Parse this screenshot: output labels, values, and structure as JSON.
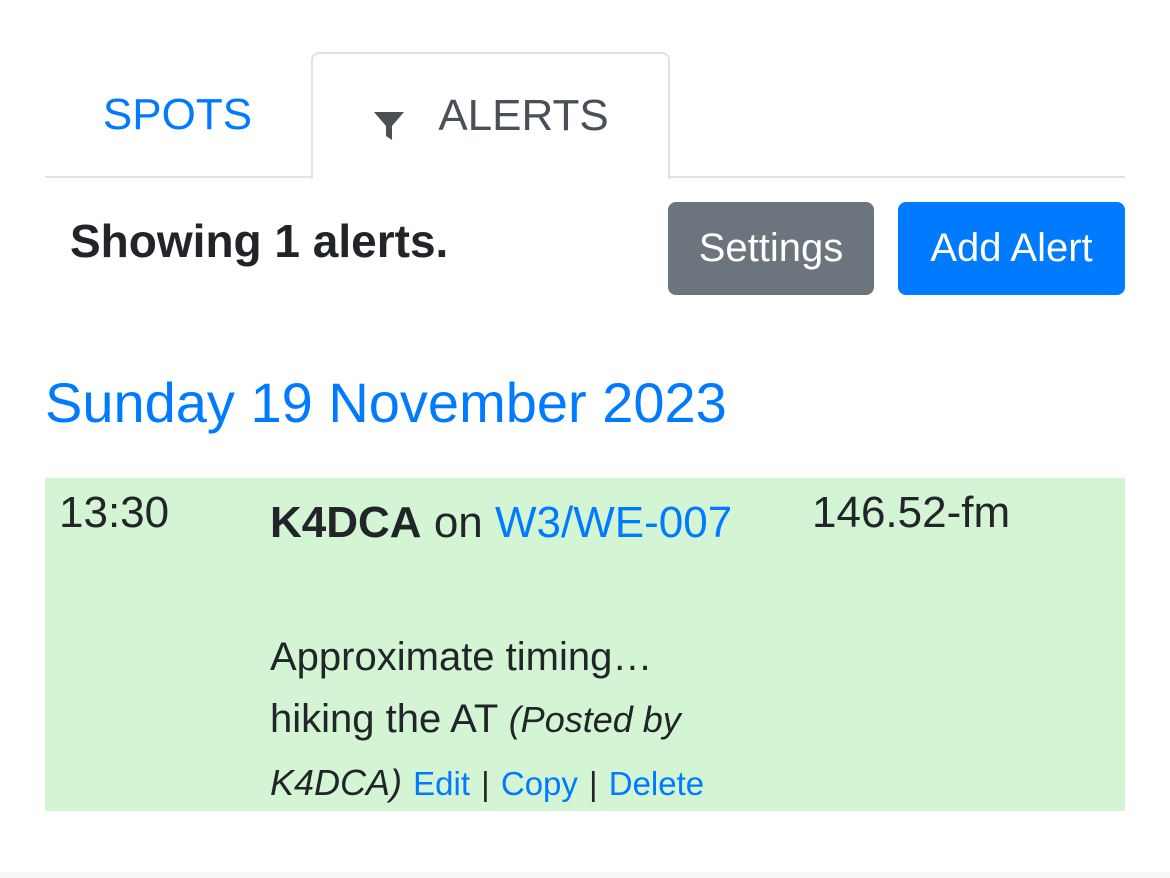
{
  "tabs": {
    "spots_label": "SPOTS",
    "alerts_label": "ALERTS",
    "alerts_icon": "filter-icon"
  },
  "toolbar": {
    "status_text": "Showing 1 alerts.",
    "settings_label": "Settings",
    "add_alert_label": "Add Alert"
  },
  "alerts": {
    "date_heading": "Sunday 19 November 2023",
    "items": [
      {
        "time": "13:30",
        "callsign": "K4DCA",
        "on_text": "on",
        "summit": "W3/WE-007",
        "frequency": "146.52-fm",
        "comment": "Approximate timing… hiking the AT",
        "posted_by": "(Posted by K4DCA)",
        "edit_label": "Edit",
        "copy_label": "Copy",
        "delete_label": "Delete",
        "separator": "|"
      }
    ]
  },
  "colors": {
    "link": "#007bff",
    "secondary_button": "#6c757d",
    "alert_row_bg": "#d4f5d4",
    "text": "#212529"
  }
}
